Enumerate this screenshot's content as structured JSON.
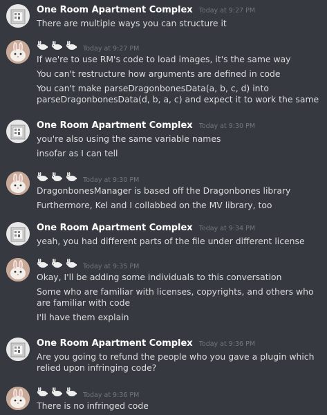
{
  "messages": [
    {
      "author": "One Room Apartment Complex",
      "avatar_icon": "apartment-building-icon",
      "timestamp": "Today at 9:27 PM",
      "lines": [
        "There are multiple ways you can structure it"
      ]
    },
    {
      "author": "🐇🐇🐇",
      "avatar_icon": "bunny-avatar-icon",
      "timestamp": "Today at 9:27 PM",
      "lines": [
        "If we're to use RM's code to load images, it's the same way",
        "You can't restructure how arguments are defined in code",
        "You can't make parseDragonbonesData(a, b, c, d) into parseDragonbonesData(d, b, a, c) and expect it to work the same"
      ]
    },
    {
      "author": "One Room Apartment Complex",
      "avatar_icon": "apartment-building-icon",
      "timestamp": "Today at 9:30 PM",
      "lines": [
        "you're also using the same variable names",
        "insofar as I can tell"
      ]
    },
    {
      "author": "🐇🐇🐇",
      "avatar_icon": "bunny-avatar-icon",
      "timestamp": "Today at 9:30 PM",
      "lines": [
        "DragonbonesManager is based off the Dragonbones library",
        "Furthermore, Kel and I collabbed on the MV library, too"
      ]
    },
    {
      "author": "One Room Apartment Complex",
      "avatar_icon": "apartment-building-icon",
      "timestamp": "Today at 9:34 PM",
      "lines": [
        "yeah, you had different parts of the file under different license"
      ]
    },
    {
      "author": "🐇🐇🐇",
      "avatar_icon": "bunny-avatar-icon",
      "timestamp": "Today at 9:35 PM",
      "lines": [
        "Okay, I'll be adding some individuals to this conversation",
        "Some who are familiar with licenses, copyrights, and others who are familiar with code",
        "I'll have them explain"
      ]
    },
    {
      "author": "One Room Apartment Complex",
      "avatar_icon": "apartment-building-icon",
      "timestamp": "Today at 9:36 PM",
      "lines": [
        "Are you going to refund the people who you gave a plugin which relied upon infringing code?"
      ]
    },
    {
      "author": "🐇🐇🐇",
      "avatar_icon": "bunny-avatar-icon",
      "timestamp": "Today at 9:36 PM",
      "lines": [
        "There is no infringed code"
      ]
    }
  ]
}
